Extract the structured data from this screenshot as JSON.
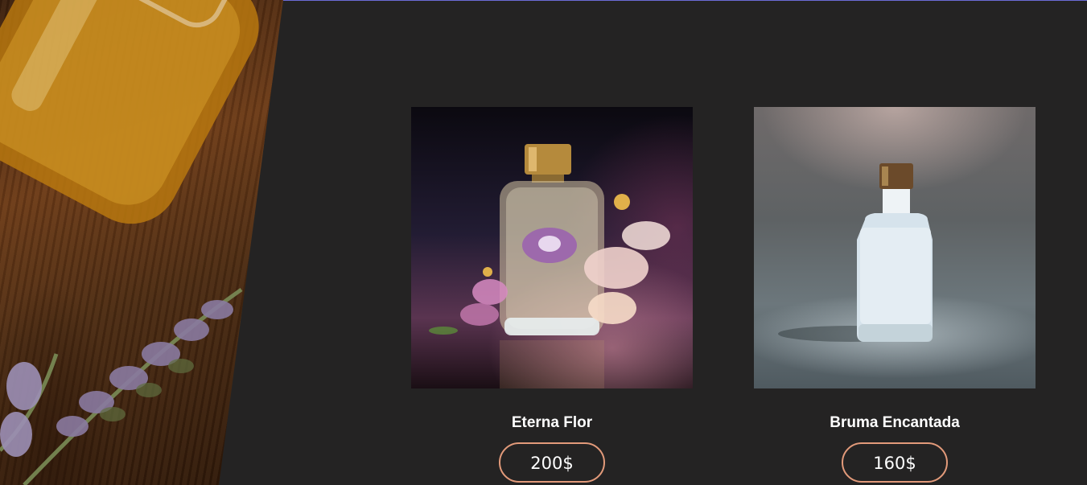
{
  "colors": {
    "background": "#242323",
    "price_border": "#e29a7a",
    "text": "#ffffff"
  },
  "products": [
    {
      "name": "Eterna Flor",
      "price": "200$",
      "image_icon": "perfume-bottle-with-flowers-icon"
    },
    {
      "name": "Bruma Encantada",
      "price": "160$",
      "image_icon": "white-perfume-bottle-icon"
    }
  ]
}
